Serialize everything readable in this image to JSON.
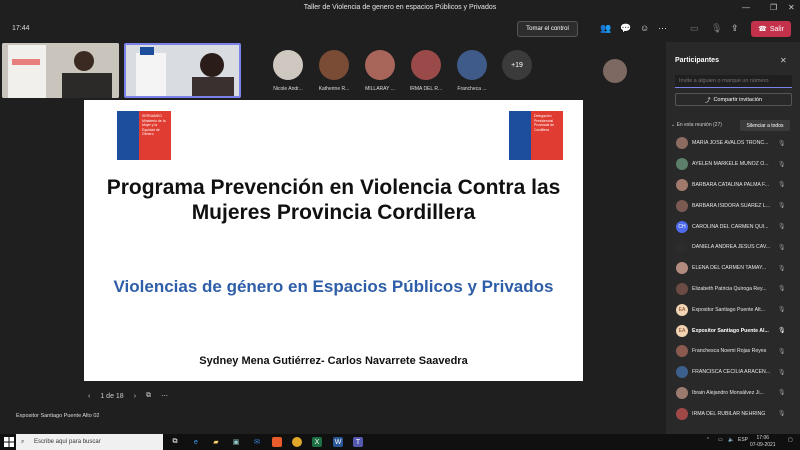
{
  "window": {
    "title": "Taller de Violencia de genero en espacios Públicos y Privados"
  },
  "meeting": {
    "time": "17:44",
    "take_control_label": "Tomar el control",
    "leave_label": "Salir",
    "leave_color": "#c4314b"
  },
  "avatars": [
    {
      "name": "Nicole Andr..."
    },
    {
      "name": "Katherine R..."
    },
    {
      "name": "MILLARAY ..."
    },
    {
      "name": "IRMA DEL R..."
    },
    {
      "name": "Francheca ..."
    }
  ],
  "more_participants": "+19",
  "slide": {
    "logo_left_text": "SERNAMEG Ministerio de la Mujer y la Equidad de Género",
    "logo_right_text": "Delegación Presidencial Provincial de Cordillera",
    "title": "Programa Prevención en Violencia Contra las Mujeres Provincia Cordillera",
    "subtitle": "Violencias de género en Espacios Públicos y Privados",
    "authors": "Sydney Mena Gutiérrez- Carlos Navarrete Saavedra",
    "subtitle_color": "#2e5ea8"
  },
  "slide_nav": {
    "page": "1 de 18"
  },
  "presenter_label": "Expositor Santiago Puente Alto 02",
  "panel": {
    "title": "Participantes",
    "invite_placeholder": "Invite a alguien o marque un número",
    "share_label": "Compartir invitación",
    "section_label": "En esta reunión (27)",
    "mute_all_label": "Silenciar a todos",
    "participants": [
      {
        "name": "MARIA JOSE AVALOS TRONC...",
        "initials": ""
      },
      {
        "name": "AYELEN MARKELE MUÑOZ O...",
        "initials": ""
      },
      {
        "name": "BÁRBARA CATALINA PALMA F...",
        "initials": ""
      },
      {
        "name": "BÁRBARA ISIDORA SUÁREZ L...",
        "initials": ""
      },
      {
        "name": "CAROLINA DEL CARMEN QUI...",
        "initials": "CH"
      },
      {
        "name": "DANIELA ANDREA JESÚS CAV...",
        "initials": ""
      },
      {
        "name": "ELENA DEL CARMEN TAMAY...",
        "initials": ""
      },
      {
        "name": "Elizabeth Patricia Quiroga Rey...",
        "initials": ""
      },
      {
        "name": "Expositor Santiago Puente Alt...",
        "initials": "EA"
      },
      {
        "name": "Expositor Santiago Puente Al...",
        "initials": "EA"
      },
      {
        "name": "Franchesca Noemi Rojas Reyes",
        "initials": ""
      },
      {
        "name": "FRANCISCA CECILIA ARACEN...",
        "initials": ""
      },
      {
        "name": "Ibrain Alejandro Monsálvez Ji...",
        "initials": ""
      },
      {
        "name": "IRMA DEL RUBILAR NEHRING",
        "initials": ""
      }
    ]
  },
  "taskbar": {
    "search_placeholder": "Escribe aquí para buscar",
    "lang": "ESP",
    "clock_time": "17:06",
    "clock_date": "07-09-2021"
  }
}
